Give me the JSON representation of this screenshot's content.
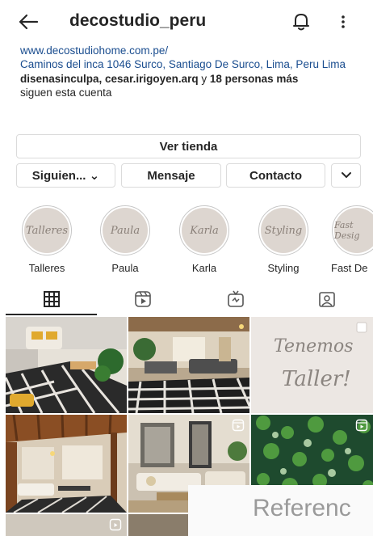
{
  "topbar": {
    "username": "decostudio_peru",
    "back_icon": "arrow-left-icon",
    "bell_icon": "bell-icon",
    "more_icon": "vertical-dots-icon"
  },
  "bio": {
    "website": "www.decostudiohome.com.pe/",
    "address": "Caminos del inca 1046 Surco, Santiago De Surco, Lima, Peru Lima",
    "followers_names": "disenasinculpa, cesar.irigoyen.arq",
    "followers_joiner": " y ",
    "followers_count": "18 personas más",
    "followers_suffix": "siguen esta cuenta"
  },
  "buttons": {
    "store": "Ver tienda",
    "following": "Siguien... ⌄",
    "message": "Mensaje",
    "contact": "Contacto",
    "chevron_icon": "chevron-down-icon"
  },
  "highlights": [
    {
      "label": "Talleres",
      "cover_text": "Talleres"
    },
    {
      "label": "Paula",
      "cover_text": "Paula"
    },
    {
      "label": "Karla",
      "cover_text": "Karla"
    },
    {
      "label": "Styling",
      "cover_text": "Styling"
    },
    {
      "label": "Fast De",
      "cover_text": "Fast Desig"
    }
  ],
  "tabs": {
    "grid_icon": "grid-icon",
    "reels_icon": "reels-icon",
    "igtv_icon": "igtv-icon",
    "tagged_icon": "tagged-icon"
  },
  "posts": [
    {
      "kind": "photo",
      "description": "living room"
    },
    {
      "kind": "photo",
      "description": "patio"
    },
    {
      "kind": "text",
      "text_line1": "Tenemos",
      "text_line2": "Taller!",
      "badge_icon": "multi-photo-icon"
    },
    {
      "kind": "photo",
      "description": "dining room"
    },
    {
      "kind": "photo",
      "description": "living room",
      "badge_icon": "reels-icon"
    },
    {
      "kind": "photo",
      "description": "garden",
      "badge_icon": "reels-icon"
    }
  ],
  "watermark": "Referenc",
  "colors": {
    "link": "#1a4d8f",
    "text": "#262626",
    "border": "#dbdbdb"
  }
}
